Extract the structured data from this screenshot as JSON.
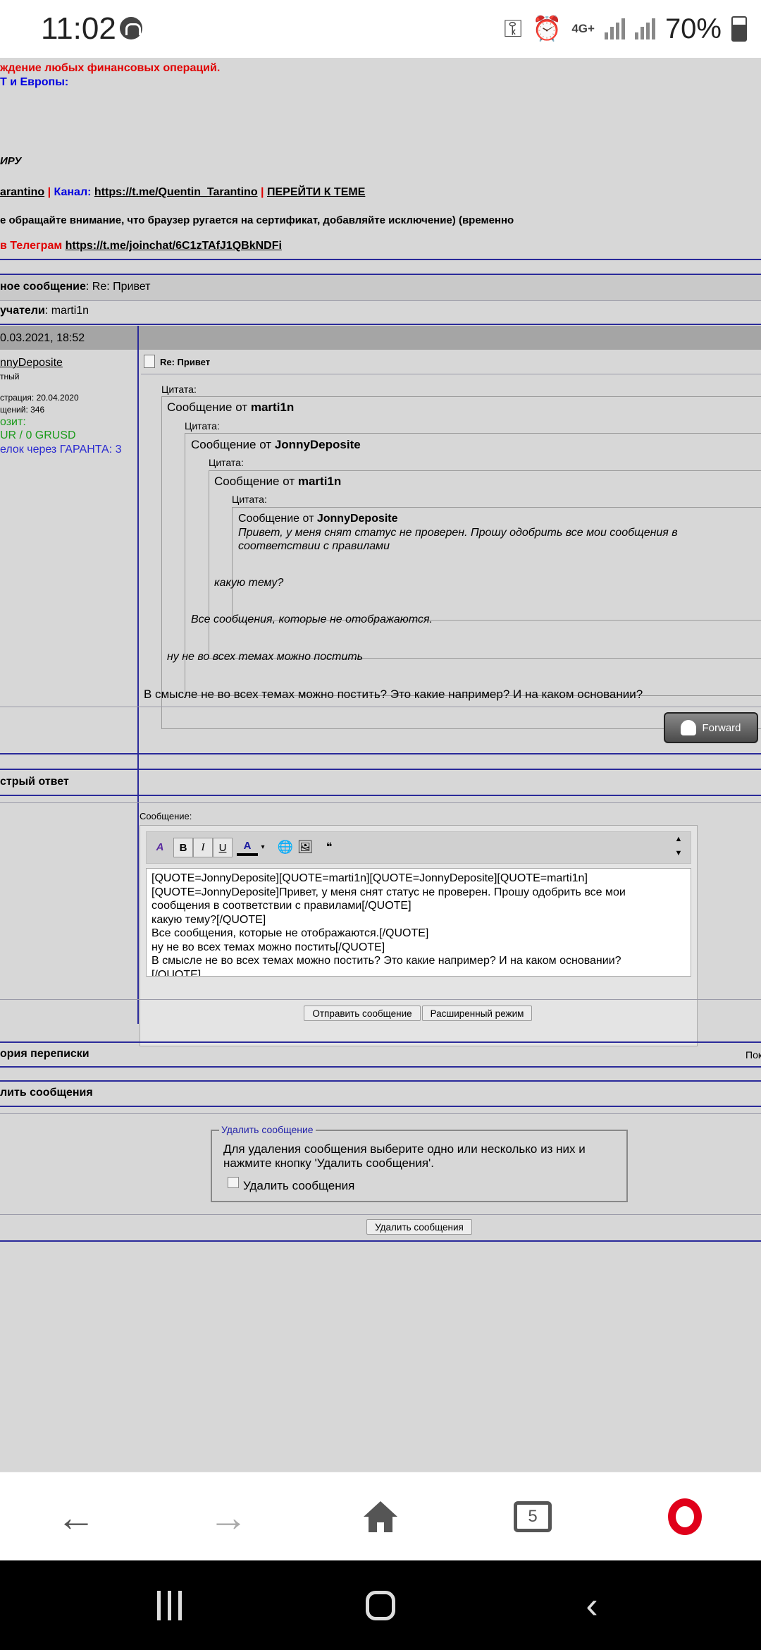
{
  "status_bar": {
    "time": "11:02",
    "network": "4G+",
    "battery": "70%"
  },
  "page": {
    "announce_line2": "ждение любых финансовых операций.",
    "announce_line3": "Т и Европы:",
    "announce_ryu": "ИРУ",
    "author_name": "arantino",
    "sep1": "|",
    "channel_label": "Канал:",
    "channel_url": "https://t.me/Quentin_Tarantino",
    "sep2": "|",
    "goto_topic": "ПЕРЕЙТИ К ТЕМЕ",
    "cert_notice": "е обращайте внимание, что браузер ругается на сертификат, добавляйте исключение) (временно",
    "telegram_label": "в Телеграм",
    "telegram_url": "https://t.me/joinchat/6C1zTAfJ1QBkNDFi",
    "subject_label": "ное сообщение",
    "subject_value": ": Re: Привет",
    "recipients_label": "учатели",
    "recipients_value": ": marti1n",
    "post_date": "0.03.2021, 18:52",
    "user_name": "nnyDeposite",
    "user_status": "тный",
    "user_reg": "страция: 20.04.2020",
    "user_posts": "щений: 346",
    "user_deposit": "озит:",
    "user_balance": "UR / 0 GRUSD",
    "user_deals": "елок через ГАРАНТА: 3",
    "post_title": "Re: Привет",
    "quote_label": "Цитата:",
    "msg_from": "Сообщение от",
    "q1_author": "marti1n",
    "q2_author": "JonnyDeposite",
    "q3_author": "marti1n",
    "q4_author": "JonnyDeposite",
    "q4_text": "Привет, у меня снят статус не проверен. Прошу одобрить все мои сообщения в соответствии с правилами",
    "q3_text": "какую тему?",
    "q2_text": "Все сообщения, которые не отображаются.",
    "q1_text": "ну не во всех темах можно постить",
    "post_body": "В смысле не во всех темах можно постить? Это какие например? И на каком основании?",
    "forward_button": "Forward",
    "quick_reply": "стрый ответ",
    "message_label": "Сообщение:",
    "editor_text": "[QUOTE=JonnyDeposite][QUOTE=marti1n][QUOTE=JonnyDeposite][QUOTE=marti1n]\n[QUOTE=JonnyDeposite]Привет, у меня снят статус не проверен. Прошу одобрить все мои\nсообщения в соответствии с правилами[/QUOTE]\nкакую тему?[/QUOTE]\nВсе сообщения, которые не отображаются.[/QUOTE]\nну не во всех темах можно постить[/QUOTE]\nВ смысле не во всех темах можно постить? Это какие например? И на каком основании?\n[/QUOTE]",
    "send_button": "Отправить сообщение",
    "advanced_button": "Расширенный режим",
    "history_label": "ория переписки",
    "history_right": "Пок",
    "delete_section": "лить сообщения",
    "delete_legend": "Удалить сообщение",
    "delete_help": "Для удаления сообщения выберите одно или несколько из них и нажмите кнопку 'Удалить сообщения'.",
    "delete_checkbox_label": "Удалить сообщения",
    "delete_button": "Удалить сообщения"
  },
  "browser_nav": {
    "tabs_count": "5"
  }
}
